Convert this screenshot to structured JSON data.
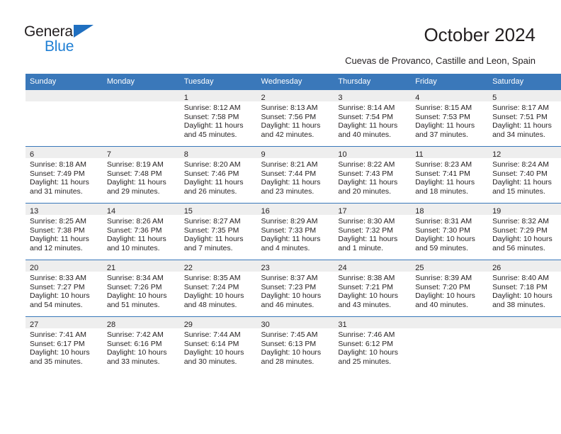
{
  "brand": {
    "name_part1": "General",
    "name_part2": "Blue",
    "triangle_color": "#1f6fc0",
    "blue_color": "#1f7fd4"
  },
  "header": {
    "title": "October 2024",
    "subtitle": "Cuevas de Provanco, Castille and Leon, Spain"
  },
  "theme": {
    "header_bg": "#3a78ba",
    "header_text": "#ffffff",
    "daynum_band_bg": "#eeeeee",
    "row_border": "#3a78ba",
    "body_text": "#231f20"
  },
  "weekday_headers": [
    "Sunday",
    "Monday",
    "Tuesday",
    "Wednesday",
    "Thursday",
    "Friday",
    "Saturday"
  ],
  "weeks": [
    [
      {
        "day": "",
        "sunrise": "",
        "sunset": "",
        "daylight_line1": "",
        "daylight_line2": ""
      },
      {
        "day": "",
        "sunrise": "",
        "sunset": "",
        "daylight_line1": "",
        "daylight_line2": ""
      },
      {
        "day": "1",
        "sunrise": "Sunrise: 8:12 AM",
        "sunset": "Sunset: 7:58 PM",
        "daylight_line1": "Daylight: 11 hours",
        "daylight_line2": "and 45 minutes."
      },
      {
        "day": "2",
        "sunrise": "Sunrise: 8:13 AM",
        "sunset": "Sunset: 7:56 PM",
        "daylight_line1": "Daylight: 11 hours",
        "daylight_line2": "and 42 minutes."
      },
      {
        "day": "3",
        "sunrise": "Sunrise: 8:14 AM",
        "sunset": "Sunset: 7:54 PM",
        "daylight_line1": "Daylight: 11 hours",
        "daylight_line2": "and 40 minutes."
      },
      {
        "day": "4",
        "sunrise": "Sunrise: 8:15 AM",
        "sunset": "Sunset: 7:53 PM",
        "daylight_line1": "Daylight: 11 hours",
        "daylight_line2": "and 37 minutes."
      },
      {
        "day": "5",
        "sunrise": "Sunrise: 8:17 AM",
        "sunset": "Sunset: 7:51 PM",
        "daylight_line1": "Daylight: 11 hours",
        "daylight_line2": "and 34 minutes."
      }
    ],
    [
      {
        "day": "6",
        "sunrise": "Sunrise: 8:18 AM",
        "sunset": "Sunset: 7:49 PM",
        "daylight_line1": "Daylight: 11 hours",
        "daylight_line2": "and 31 minutes."
      },
      {
        "day": "7",
        "sunrise": "Sunrise: 8:19 AM",
        "sunset": "Sunset: 7:48 PM",
        "daylight_line1": "Daylight: 11 hours",
        "daylight_line2": "and 29 minutes."
      },
      {
        "day": "8",
        "sunrise": "Sunrise: 8:20 AM",
        "sunset": "Sunset: 7:46 PM",
        "daylight_line1": "Daylight: 11 hours",
        "daylight_line2": "and 26 minutes."
      },
      {
        "day": "9",
        "sunrise": "Sunrise: 8:21 AM",
        "sunset": "Sunset: 7:44 PM",
        "daylight_line1": "Daylight: 11 hours",
        "daylight_line2": "and 23 minutes."
      },
      {
        "day": "10",
        "sunrise": "Sunrise: 8:22 AM",
        "sunset": "Sunset: 7:43 PM",
        "daylight_line1": "Daylight: 11 hours",
        "daylight_line2": "and 20 minutes."
      },
      {
        "day": "11",
        "sunrise": "Sunrise: 8:23 AM",
        "sunset": "Sunset: 7:41 PM",
        "daylight_line1": "Daylight: 11 hours",
        "daylight_line2": "and 18 minutes."
      },
      {
        "day": "12",
        "sunrise": "Sunrise: 8:24 AM",
        "sunset": "Sunset: 7:40 PM",
        "daylight_line1": "Daylight: 11 hours",
        "daylight_line2": "and 15 minutes."
      }
    ],
    [
      {
        "day": "13",
        "sunrise": "Sunrise: 8:25 AM",
        "sunset": "Sunset: 7:38 PM",
        "daylight_line1": "Daylight: 11 hours",
        "daylight_line2": "and 12 minutes."
      },
      {
        "day": "14",
        "sunrise": "Sunrise: 8:26 AM",
        "sunset": "Sunset: 7:36 PM",
        "daylight_line1": "Daylight: 11 hours",
        "daylight_line2": "and 10 minutes."
      },
      {
        "day": "15",
        "sunrise": "Sunrise: 8:27 AM",
        "sunset": "Sunset: 7:35 PM",
        "daylight_line1": "Daylight: 11 hours",
        "daylight_line2": "and 7 minutes."
      },
      {
        "day": "16",
        "sunrise": "Sunrise: 8:29 AM",
        "sunset": "Sunset: 7:33 PM",
        "daylight_line1": "Daylight: 11 hours",
        "daylight_line2": "and 4 minutes."
      },
      {
        "day": "17",
        "sunrise": "Sunrise: 8:30 AM",
        "sunset": "Sunset: 7:32 PM",
        "daylight_line1": "Daylight: 11 hours",
        "daylight_line2": "and 1 minute."
      },
      {
        "day": "18",
        "sunrise": "Sunrise: 8:31 AM",
        "sunset": "Sunset: 7:30 PM",
        "daylight_line1": "Daylight: 10 hours",
        "daylight_line2": "and 59 minutes."
      },
      {
        "day": "19",
        "sunrise": "Sunrise: 8:32 AM",
        "sunset": "Sunset: 7:29 PM",
        "daylight_line1": "Daylight: 10 hours",
        "daylight_line2": "and 56 minutes."
      }
    ],
    [
      {
        "day": "20",
        "sunrise": "Sunrise: 8:33 AM",
        "sunset": "Sunset: 7:27 PM",
        "daylight_line1": "Daylight: 10 hours",
        "daylight_line2": "and 54 minutes."
      },
      {
        "day": "21",
        "sunrise": "Sunrise: 8:34 AM",
        "sunset": "Sunset: 7:26 PM",
        "daylight_line1": "Daylight: 10 hours",
        "daylight_line2": "and 51 minutes."
      },
      {
        "day": "22",
        "sunrise": "Sunrise: 8:35 AM",
        "sunset": "Sunset: 7:24 PM",
        "daylight_line1": "Daylight: 10 hours",
        "daylight_line2": "and 48 minutes."
      },
      {
        "day": "23",
        "sunrise": "Sunrise: 8:37 AM",
        "sunset": "Sunset: 7:23 PM",
        "daylight_line1": "Daylight: 10 hours",
        "daylight_line2": "and 46 minutes."
      },
      {
        "day": "24",
        "sunrise": "Sunrise: 8:38 AM",
        "sunset": "Sunset: 7:21 PM",
        "daylight_line1": "Daylight: 10 hours",
        "daylight_line2": "and 43 minutes."
      },
      {
        "day": "25",
        "sunrise": "Sunrise: 8:39 AM",
        "sunset": "Sunset: 7:20 PM",
        "daylight_line1": "Daylight: 10 hours",
        "daylight_line2": "and 40 minutes."
      },
      {
        "day": "26",
        "sunrise": "Sunrise: 8:40 AM",
        "sunset": "Sunset: 7:18 PM",
        "daylight_line1": "Daylight: 10 hours",
        "daylight_line2": "and 38 minutes."
      }
    ],
    [
      {
        "day": "27",
        "sunrise": "Sunrise: 7:41 AM",
        "sunset": "Sunset: 6:17 PM",
        "daylight_line1": "Daylight: 10 hours",
        "daylight_line2": "and 35 minutes."
      },
      {
        "day": "28",
        "sunrise": "Sunrise: 7:42 AM",
        "sunset": "Sunset: 6:16 PM",
        "daylight_line1": "Daylight: 10 hours",
        "daylight_line2": "and 33 minutes."
      },
      {
        "day": "29",
        "sunrise": "Sunrise: 7:44 AM",
        "sunset": "Sunset: 6:14 PM",
        "daylight_line1": "Daylight: 10 hours",
        "daylight_line2": "and 30 minutes."
      },
      {
        "day": "30",
        "sunrise": "Sunrise: 7:45 AM",
        "sunset": "Sunset: 6:13 PM",
        "daylight_line1": "Daylight: 10 hours",
        "daylight_line2": "and 28 minutes."
      },
      {
        "day": "31",
        "sunrise": "Sunrise: 7:46 AM",
        "sunset": "Sunset: 6:12 PM",
        "daylight_line1": "Daylight: 10 hours",
        "daylight_line2": "and 25 minutes."
      },
      {
        "day": "",
        "sunrise": "",
        "sunset": "",
        "daylight_line1": "",
        "daylight_line2": ""
      },
      {
        "day": "",
        "sunrise": "",
        "sunset": "",
        "daylight_line1": "",
        "daylight_line2": ""
      }
    ]
  ]
}
